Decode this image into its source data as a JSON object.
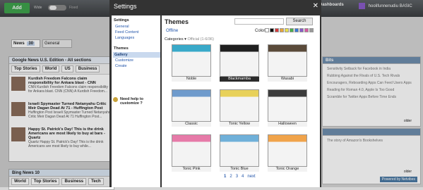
{
  "topbar": {
    "add_label": "Add",
    "wide_label": "Wide",
    "fixed_label": "Fixed",
    "dashboards_label": "Dashboards",
    "user_label": "hoolifunnenudiu BASIC"
  },
  "left": {
    "tabs": [
      {
        "label": "News",
        "count": "30"
      },
      {
        "label": "General"
      }
    ],
    "widget_title": "Google News U.S. Edition - All sections",
    "widget_tabs": [
      "Top Stories",
      "World",
      "US",
      "Business"
    ],
    "items": [
      {
        "title": "Kurdish Freedom Falcons claim responsibility for Ankara blast - CNN",
        "snippet": "CNN Kurdish Freedom Falcons claim responsibility for Ankara blast. CNN (CNN) A Kurdish Freedom..."
      },
      {
        "title": "Israeli Spymaster Turned Netanyahu Critic Meir Dagan Dead At 71 - Huffington Post",
        "snippet": "Huffington Post Israeli Spymaster Turned Netanyahu Critic Meir Dagan Dead At 71 Huffington Post..."
      },
      {
        "title": "Happy St. Patrick's Day! This is the drink Americans are most likely to buy at bars - Quartz",
        "snippet": "Quartz Happy St. Patrick's Day! This is the drink Americans are most likely to buy while..."
      }
    ],
    "widget2_title": "Bing News",
    "widget2_count": "10",
    "widget2_tabs": [
      "World",
      "Top Stories",
      "Business",
      "Tech"
    ]
  },
  "right": {
    "w1_title": "Bits",
    "w1_lines": [
      "Sensitivity Setback for Facebook in India",
      "Rubbing Against the Rivals of U.S. Tech Rivals",
      "Encouragers, Reboarding Apps Can Feed Users Apps",
      "Reading for Roman 4.0, Apple Is Too Good",
      "Scramble for Twitter Apps Before Time Ends"
    ],
    "w1_more": "older",
    "w2_lines": [
      "The story of Amazon's Bookshelves"
    ],
    "w2_more": "older",
    "powered": "Powered by Netvibes"
  },
  "settings": {
    "title": "Settings",
    "sidebar": {
      "settings_header": "Settings",
      "settings_links": [
        "General",
        "Feed Content",
        "Languages"
      ],
      "themes_header": "Themes",
      "themes_links": [
        "Gallery",
        "Customize",
        "Create"
      ],
      "help": "Need help to customize ?"
    },
    "content": {
      "title": "Themes",
      "search_placeholder": "",
      "search_button": "Search",
      "offline_label": "Offline",
      "colors_label": "Colors:",
      "categories_label": "Categories",
      "categories_count": "Official (1-6/36)",
      "themes": [
        {
          "name": "Noble",
          "color": "#39a9c9"
        },
        {
          "name": "Blackmamba",
          "color": "#1f1f1f",
          "selected": true
        },
        {
          "name": "Wasabi",
          "color": "#5a4a3a"
        },
        {
          "name": "Classic",
          "color": "#6f9bcc"
        },
        {
          "name": "Tonic Yellow",
          "color": "#e8d15a"
        },
        {
          "name": "Halloween",
          "color": "#3c3c3c"
        },
        {
          "name": "Tonic Pink",
          "color": "#e67aa8"
        },
        {
          "name": "Tonic Blue",
          "color": "#6fb0d9"
        },
        {
          "name": "Tonic Orange",
          "color": "#f0a34a"
        }
      ],
      "pages": [
        "1",
        "2",
        "3",
        "4",
        "next"
      ]
    },
    "swatches": [
      "#ffffff",
      "#000000",
      "#d63a3a",
      "#e8a33a",
      "#e8e04a",
      "#4ab04a",
      "#3a7ad6",
      "#8a5cc9",
      "#d65aa0",
      "#9a9a9a"
    ]
  }
}
